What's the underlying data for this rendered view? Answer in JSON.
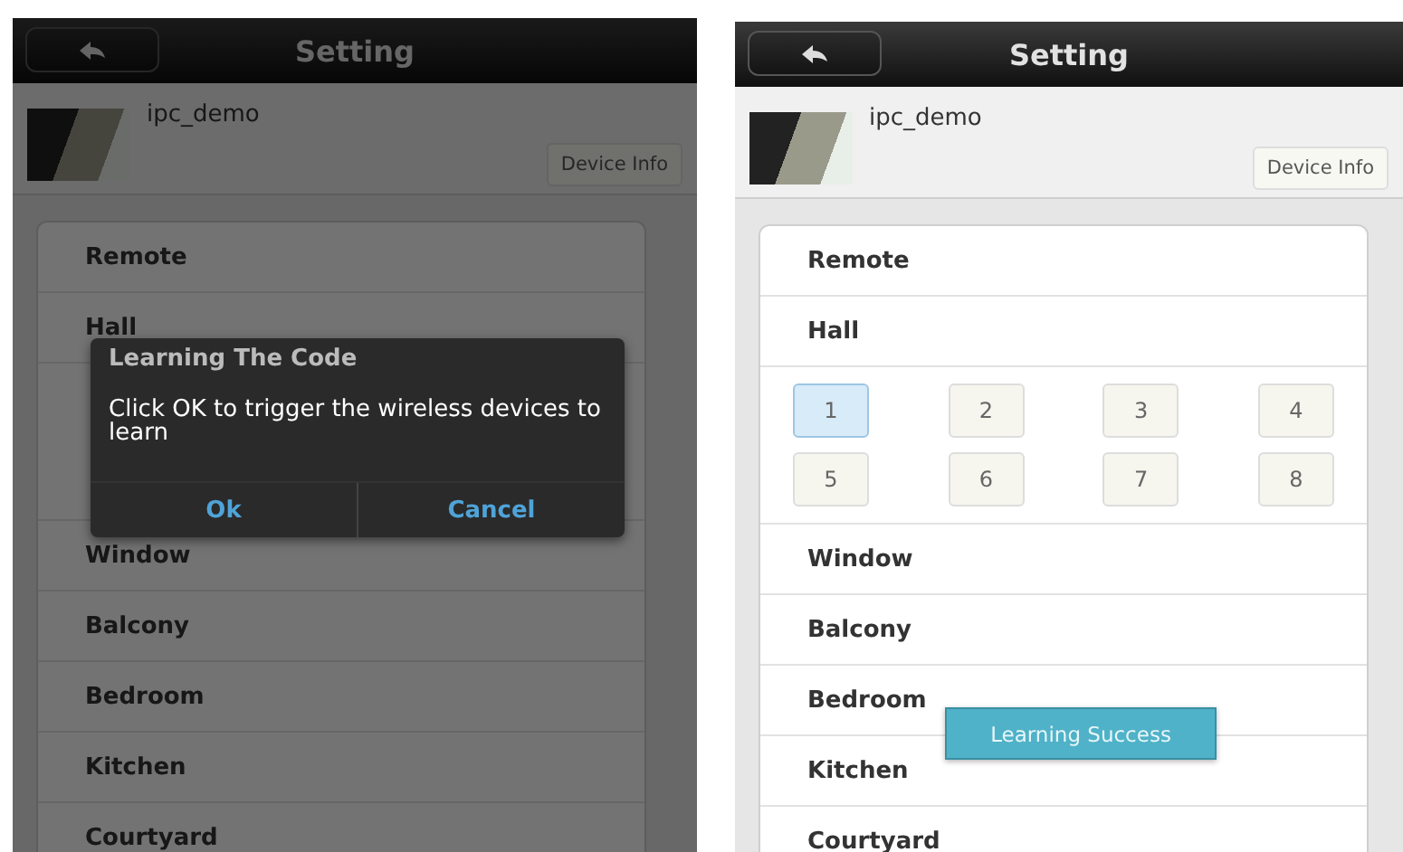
{
  "screens": [
    {
      "title": "Setting",
      "device_name": "ipc_demo",
      "device_info_button": "Device Info",
      "dimmed": true,
      "list": [
        {
          "kind": "room",
          "name": "Remote"
        },
        {
          "kind": "room",
          "name": "Hall"
        },
        {
          "kind": "covered_keypad"
        },
        {
          "kind": "room",
          "name": "Window"
        },
        {
          "kind": "room",
          "name": "Balcony"
        },
        {
          "kind": "room",
          "name": "Bedroom"
        },
        {
          "kind": "room",
          "name": "Kitchen"
        },
        {
          "kind": "room",
          "name": "Courtyard"
        }
      ],
      "dialog": {
        "title": "Learning The Code",
        "message": "Click OK to trigger the wireless devices to learn",
        "buttons": [
          "Ok",
          "Cancel"
        ]
      }
    },
    {
      "title": "Setting",
      "device_name": "ipc_demo",
      "device_info_button": "Device Info",
      "list": [
        {
          "kind": "room",
          "name": "Remote"
        },
        {
          "kind": "room",
          "name": "Hall"
        },
        {
          "kind": "keypad",
          "keys": [
            {
              "label": "1",
              "selected": true
            },
            {
              "label": "2",
              "selected": false
            },
            {
              "label": "3",
              "selected": false
            },
            {
              "label": "4",
              "selected": false
            },
            {
              "label": "5",
              "selected": false
            },
            {
              "label": "6",
              "selected": false
            },
            {
              "label": "7",
              "selected": false
            },
            {
              "label": "8",
              "selected": false
            }
          ]
        },
        {
          "kind": "room",
          "name": "Window"
        },
        {
          "kind": "room",
          "name": "Balcony"
        },
        {
          "kind": "room",
          "name": "Bedroom"
        },
        {
          "kind": "room",
          "name": "Kitchen"
        },
        {
          "kind": "room",
          "name": "Courtyard"
        }
      ],
      "toast": "Learning Success"
    }
  ]
}
